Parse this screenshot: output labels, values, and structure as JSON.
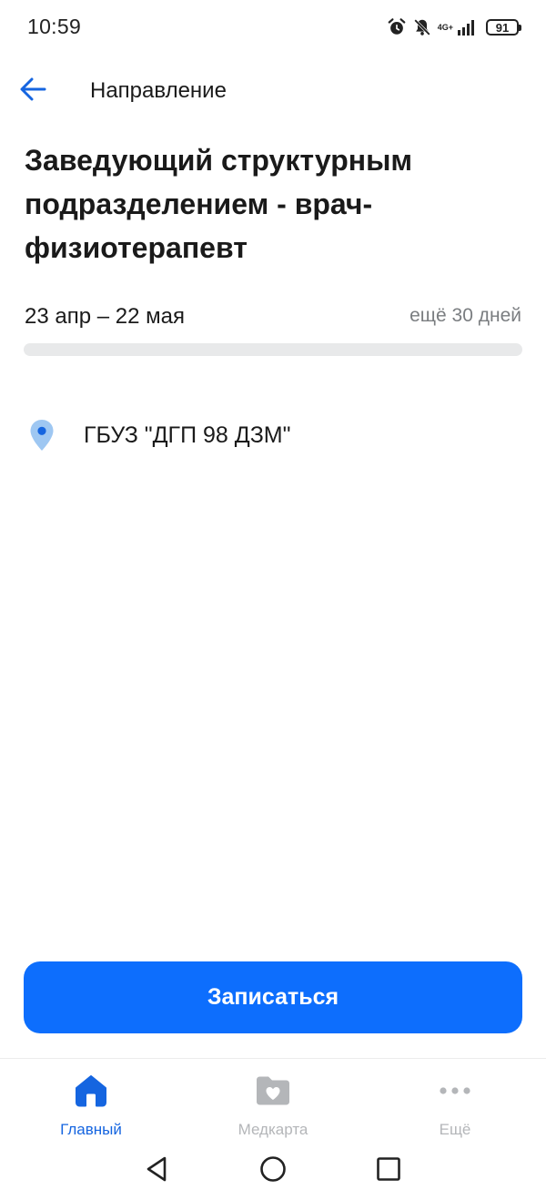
{
  "status_bar": {
    "time": "10:59",
    "network_label": "4G+",
    "battery": "91",
    "icons": [
      "alarm-icon",
      "mute-icon",
      "signal-icon",
      "battery-icon"
    ]
  },
  "header": {
    "back_icon": "arrow-left-icon",
    "title": "Направление"
  },
  "referral": {
    "position_title": "Заведующий структурным подразделением - врач-физиотерапевт",
    "date_range": "23 апр – 22 мая",
    "days_left": "ещё 30 дней",
    "progress_percent": 0,
    "location_icon": "location-pin-icon",
    "location": "ГБУЗ \"ДГП 98 ДЗМ\""
  },
  "actions": {
    "book_label": "Записаться"
  },
  "bottom_nav": {
    "items": [
      {
        "label": "Главный",
        "icon": "home-icon",
        "active": true
      },
      {
        "label": "Медкарта",
        "icon": "medcard-folder-icon",
        "active": false
      },
      {
        "label": "Ещё",
        "icon": "more-dots-icon",
        "active": false
      }
    ]
  },
  "system_nav": {
    "icons": [
      "back-triangle-icon",
      "home-circle-icon",
      "recents-square-icon"
    ]
  },
  "colors": {
    "accent": "#0d6efd",
    "active_nav": "#1565e0",
    "muted_text": "#7a7d80",
    "inactive_nav": "#b4b6b9",
    "progress_track": "#e8e9ea",
    "location_pin": "#9ec7f2"
  }
}
